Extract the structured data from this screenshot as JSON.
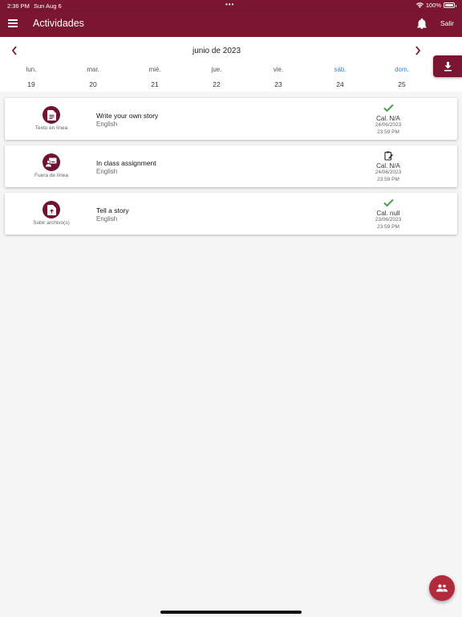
{
  "status_bar": {
    "time": "2:36 PM",
    "date": "Sun Aug 6",
    "dots": "•••",
    "battery": "100%"
  },
  "app_bar": {
    "title": "Actividades",
    "logout_label": "Salir"
  },
  "calendar": {
    "month_label": "junio de 2023",
    "days": [
      {
        "name": "lun.",
        "num": "19"
      },
      {
        "name": "mar.",
        "num": "20"
      },
      {
        "name": "mié.",
        "num": "21"
      },
      {
        "name": "jue.",
        "num": "22"
      },
      {
        "name": "vie.",
        "num": "23"
      },
      {
        "name": "sáb.",
        "num": "24"
      },
      {
        "name": "dom.",
        "num": "25"
      }
    ]
  },
  "activities": [
    {
      "type_label": "Texto en línea",
      "type_icon": "document-icon",
      "name": "Write your own story",
      "course": "English",
      "status_icon": "check-icon",
      "grade": "Cal. N/A",
      "due_date": "24/06/2023",
      "due_time": "23:59 PM"
    },
    {
      "type_label": "Fuera de línea",
      "type_icon": "offline-user-icon",
      "name": "In class assignment",
      "course": "English",
      "status_icon": "clipboard-edit-icon",
      "grade": "Cal. N/A",
      "due_date": "24/06/2023",
      "due_time": "23:59 PM"
    },
    {
      "type_label": "Subir archivo(s)",
      "type_icon": "file-upload-icon",
      "name": "Tell a story",
      "course": "English",
      "status_icon": "check-icon",
      "grade": "Cal. null",
      "due_date": "23/06/2023",
      "due_time": "23:59 PM"
    }
  ],
  "colors": {
    "primary": "#7a1630",
    "icon_bg": "#6e1431",
    "fab": "#b22a3c",
    "check": "#43a047",
    "weekend": "#2e86de"
  }
}
